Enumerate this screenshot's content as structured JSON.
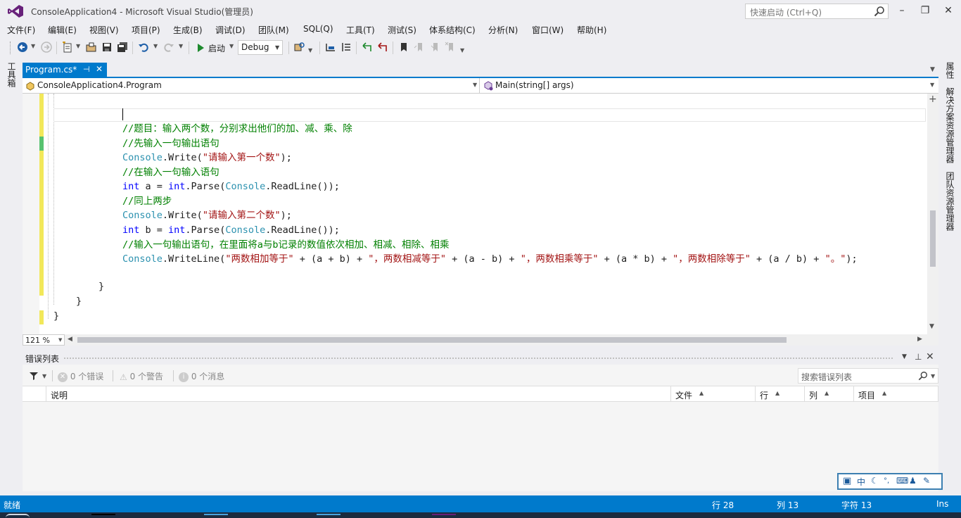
{
  "window": {
    "title": "ConsoleApplication4 - Microsoft Visual Studio(管理员)",
    "quick_launch_placeholder": "快速启动 (Ctrl+Q)"
  },
  "menu": [
    "文件(F)",
    "编辑(E)",
    "视图(V)",
    "项目(P)",
    "生成(B)",
    "调试(D)",
    "团队(M)",
    "SQL(Q)",
    "工具(T)",
    "测试(S)",
    "体系结构(C)",
    "分析(N)",
    "窗口(W)",
    "帮助(H)"
  ],
  "toolbar": {
    "start_label": "启动",
    "configuration": "Debug"
  },
  "side_tabs": {
    "left": "工具箱",
    "right": [
      "属性",
      "解决方案资源管理器",
      "团队资源管理器"
    ]
  },
  "document": {
    "tab_label": "Program.cs*",
    "nav_type": "ConsoleApplication4.Program",
    "nav_member": "Main(string[] args)",
    "zoom": "121 %"
  },
  "code": {
    "lines": [
      [
        {
          "t": "//题目：输入两个数，分别求出他们的加、减、乘、除",
          "c": "comment"
        }
      ],
      [
        {
          "t": "//先输入一句输出语句",
          "c": "comment"
        }
      ],
      [
        {
          "t": "Console",
          "c": "type"
        },
        {
          "t": ".Write(",
          "c": "plain"
        },
        {
          "t": "\"请输入第一个数\"",
          "c": "str"
        },
        {
          "t": ");",
          "c": "plain"
        }
      ],
      [
        {
          "t": "//在输入一句输入语句",
          "c": "comment"
        }
      ],
      [
        {
          "t": "int",
          "c": "kw"
        },
        {
          "t": " a = ",
          "c": "plain"
        },
        {
          "t": "int",
          "c": "kw"
        },
        {
          "t": ".Parse(",
          "c": "plain"
        },
        {
          "t": "Console",
          "c": "type"
        },
        {
          "t": ".ReadLine());",
          "c": "plain"
        }
      ],
      [
        {
          "t": "//同上两步",
          "c": "comment"
        }
      ],
      [
        {
          "t": "Console",
          "c": "type"
        },
        {
          "t": ".Write(",
          "c": "plain"
        },
        {
          "t": "\"请输入第二个数\"",
          "c": "str"
        },
        {
          "t": ");",
          "c": "plain"
        }
      ],
      [
        {
          "t": "int",
          "c": "kw"
        },
        {
          "t": " b = ",
          "c": "plain"
        },
        {
          "t": "int",
          "c": "kw"
        },
        {
          "t": ".Parse(",
          "c": "plain"
        },
        {
          "t": "Console",
          "c": "type"
        },
        {
          "t": ".ReadLine());",
          "c": "plain"
        }
      ],
      [
        {
          "t": "//输入一句输出语句，在里面将a与b记录的数值依次相加、相减、相除、相乘",
          "c": "comment"
        }
      ],
      [
        {
          "t": "Console",
          "c": "type"
        },
        {
          "t": ".WriteLine(",
          "c": "plain"
        },
        {
          "t": "\"两数相加等于\"",
          "c": "str"
        },
        {
          "t": " + (a + b) + ",
          "c": "plain"
        },
        {
          "t": "\"，两数相减等于\"",
          "c": "str"
        },
        {
          "t": " + (a - b) + ",
          "c": "plain"
        },
        {
          "t": "\"，两数相乘等于\"",
          "c": "str"
        },
        {
          "t": " + (a * b) + ",
          "c": "plain"
        },
        {
          "t": "\"，两数相除等于\"",
          "c": "str"
        },
        {
          "t": " + (a / b) + ",
          "c": "plain"
        },
        {
          "t": "\"。\"",
          "c": "str"
        },
        {
          "t": ");",
          "c": "plain"
        }
      ]
    ],
    "closing_braces": [
      "}",
      "}",
      "}"
    ]
  },
  "error_list": {
    "title": "错误列表",
    "errors": "0 个错误",
    "warnings": "0 个警告",
    "messages": "0 个消息",
    "search_placeholder": "搜索错误列表",
    "columns": [
      "说明",
      "文件",
      "行",
      "列",
      "项目"
    ]
  },
  "ime": {
    "lang": "中"
  },
  "status": {
    "ready": "就绪",
    "line": "行 28",
    "col": "列 13",
    "char": "字符 13",
    "mode": "Ins"
  },
  "colors": {
    "accent": "#007acc",
    "comment": "#008000",
    "keyword": "#0000ff",
    "type": "#2b91af",
    "string": "#a31515",
    "changed_unsaved": "#f2e85a",
    "changed_saved": "#57c26f"
  }
}
